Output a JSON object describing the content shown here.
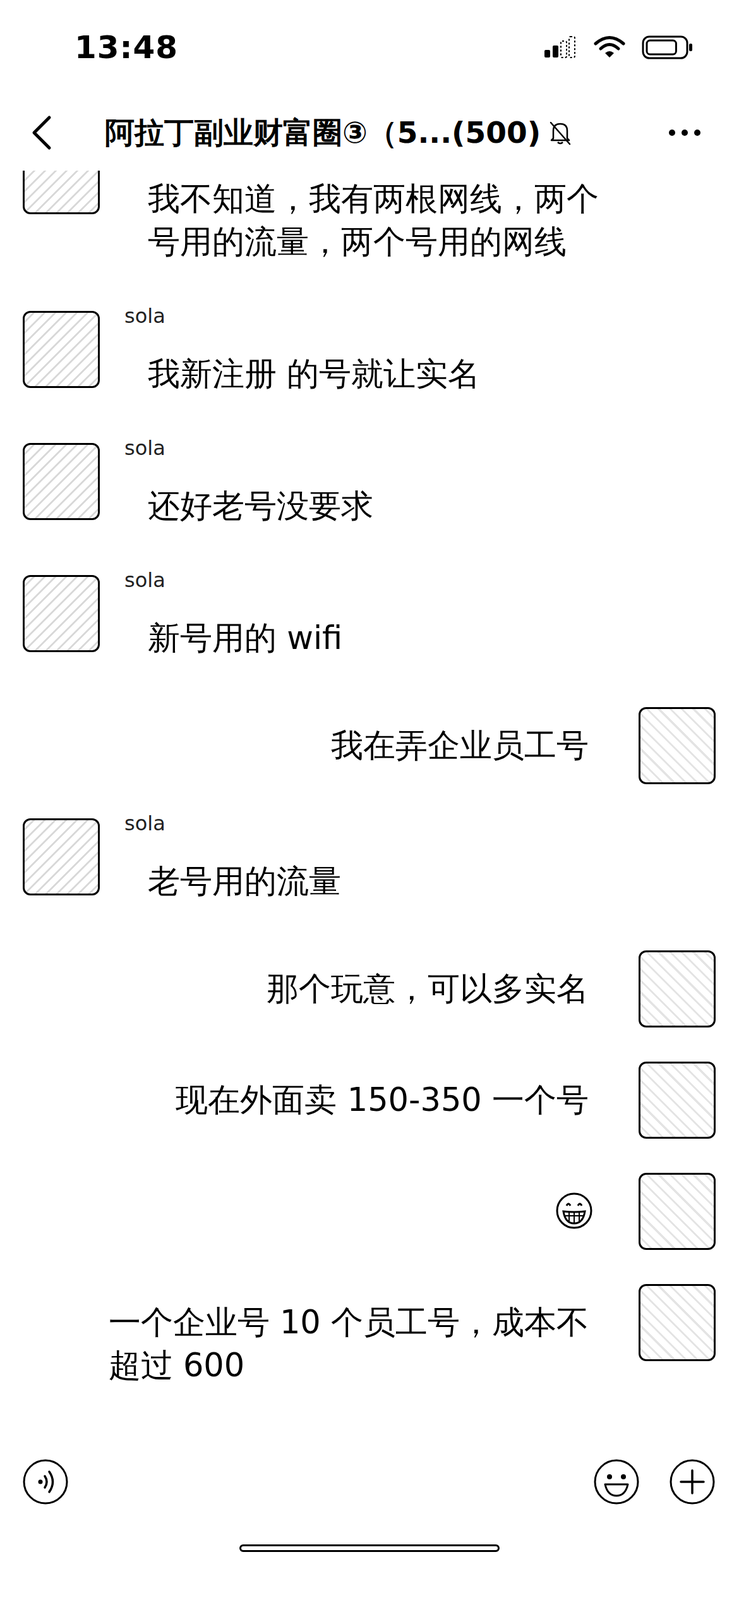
{
  "status_bar": {
    "time": "13:48",
    "signal": {
      "level": 0.5
    },
    "battery": {
      "level": 0.8
    }
  },
  "header": {
    "title": "阿拉丁副业财富圈③（5...(500)",
    "muted": true
  },
  "messages": [
    {
      "side": "left",
      "kind": "text",
      "lines": [
        "我不知道，我有两根网线，两个",
        "号用的流量，两个号用的网线"
      ]
    },
    {
      "side": "left",
      "kind": "text",
      "sender": "sola",
      "lines": [
        "我新注册 的号就让实名"
      ]
    },
    {
      "side": "left",
      "kind": "text",
      "sender": "sola",
      "lines": [
        "还好老号没要求"
      ]
    },
    {
      "side": "left",
      "kind": "text",
      "sender": "sola",
      "lines": [
        "新号用的 wifi"
      ]
    },
    {
      "side": "right",
      "kind": "text",
      "lines": [
        "我在弄企业员工号"
      ]
    },
    {
      "side": "left",
      "kind": "text",
      "sender": "sola",
      "lines": [
        "老号用的流量"
      ]
    },
    {
      "side": "right",
      "kind": "text",
      "lines": [
        "那个玩意，可以多实名"
      ]
    },
    {
      "side": "right",
      "kind": "text",
      "lines": [
        "现在外面卖 150-350 一个号"
      ]
    },
    {
      "side": "right",
      "kind": "emoji"
    },
    {
      "side": "right",
      "kind": "text",
      "lines": [
        "一个企业号 10 个员工号，成本不",
        "超过 600"
      ]
    }
  ]
}
